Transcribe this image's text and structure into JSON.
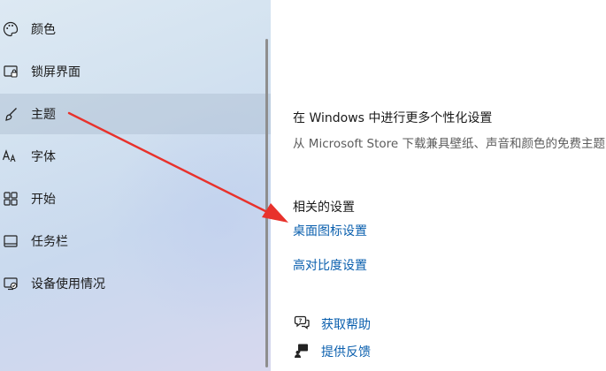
{
  "sidebar": {
    "items": [
      {
        "label": "颜色",
        "icon": "palette-icon"
      },
      {
        "label": "锁屏界面",
        "icon": "lock-screen-icon"
      },
      {
        "label": "主题",
        "icon": "brush-icon",
        "selected": true
      },
      {
        "label": "字体",
        "icon": "font-icon"
      },
      {
        "label": "开始",
        "icon": "start-grid-icon"
      },
      {
        "label": "任务栏",
        "icon": "taskbar-icon"
      },
      {
        "label": "设备使用情况",
        "icon": "device-usage-icon"
      }
    ]
  },
  "main": {
    "store": {
      "title": "在 Windows 中进行更多个性化设置",
      "desc": "从 Microsoft Store 下载兼具壁纸、声音和颜色的免费主题"
    },
    "related": {
      "title": "相关的设置",
      "links": [
        "桌面图标设置",
        "高对比度设置"
      ]
    },
    "help": {
      "get_help": "获取帮助",
      "feedback": "提供反馈"
    }
  },
  "annotation": {
    "arrow_color": "#e8322c",
    "type": "red-arrow"
  },
  "colors": {
    "accent_link": "#0a5fae",
    "selected_bg": "#b4c1d2"
  }
}
